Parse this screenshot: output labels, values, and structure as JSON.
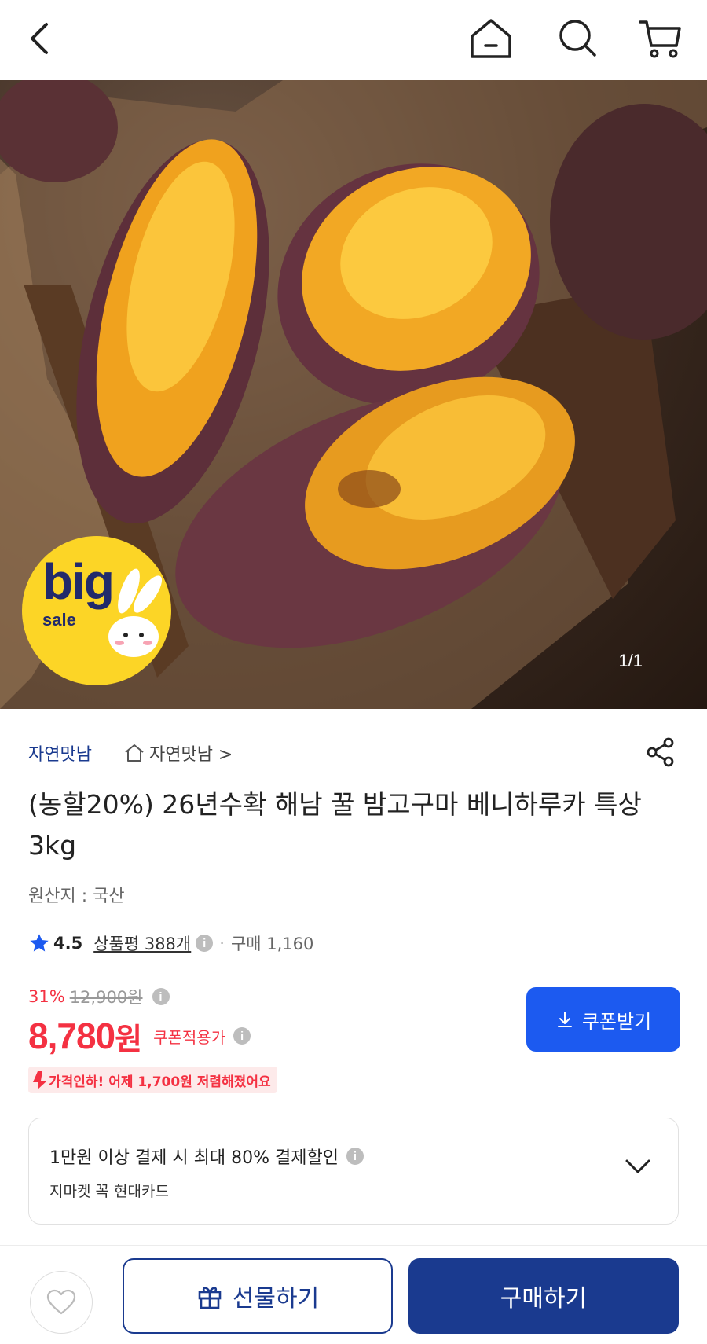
{
  "nav": {
    "back_icon": "chevron-left-icon",
    "home_icon": "home-icon",
    "search_icon": "search-icon",
    "cart_icon": "cart-icon"
  },
  "hero": {
    "badge_big": "big",
    "badge_sale": "sale",
    "image_counter": "1/1"
  },
  "seller": {
    "name": "자연맛남",
    "store_link": "자연맛남 >"
  },
  "product": {
    "title": "(농할20%) 26년수확 해남 꿀 밤고구마 베니하루카 특상 3kg",
    "origin": "원산지 : 국산"
  },
  "rating": {
    "score": "4.5",
    "review_label": "상품평 388개",
    "purchase_label": "구매 1,160"
  },
  "price": {
    "discount_pct": "31%",
    "original_price": "12,900원",
    "sale_price": "8,780",
    "unit": "원",
    "coupon_price_label": "쿠폰적용가",
    "price_drop_text": "가격인하! 어제 1,700원 저렴해졌어요",
    "coupon_button": "쿠폰받기"
  },
  "card_promo": {
    "line1": "1만원 이상 결제 시 최대  80% 결제할인",
    "line2": "지마켓 꼭 현대카드"
  },
  "bottom": {
    "gift_button": "선물하기",
    "buy_button": "구매하기"
  },
  "colors": {
    "accent_red": "#f43142",
    "brand_navy": "#1a3a8f",
    "coupon_blue": "#1c5af0",
    "badge_yellow": "#fcd526"
  }
}
